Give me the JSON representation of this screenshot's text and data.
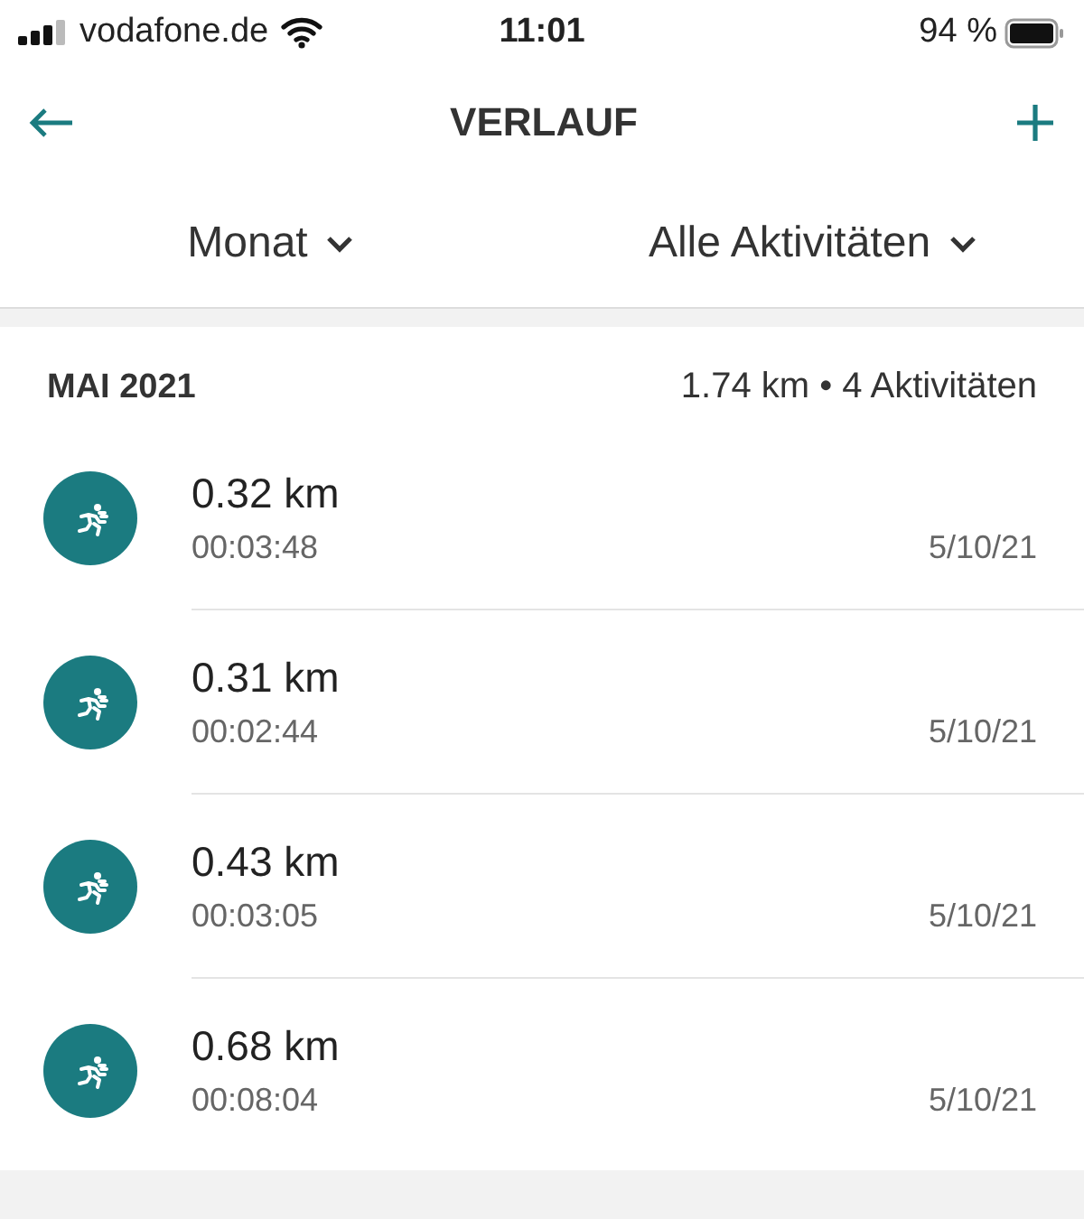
{
  "status_bar": {
    "carrier": "vodafone.de",
    "time": "11:01",
    "battery": "94 %"
  },
  "nav": {
    "title": "VERLAUF"
  },
  "filters": [
    {
      "label": "Monat"
    },
    {
      "label": "Alle Aktivitäten"
    }
  ],
  "section": {
    "title": "MAI 2021",
    "summary": "1.74 km • 4 Aktivitäten"
  },
  "activities": [
    {
      "distance": "0.32 km",
      "duration": "00:03:48",
      "date": "5/10/21"
    },
    {
      "distance": "0.31 km",
      "duration": "00:02:44",
      "date": "5/10/21"
    },
    {
      "distance": "0.43 km",
      "duration": "00:03:05",
      "date": "5/10/21"
    },
    {
      "distance": "0.68 km",
      "duration": "00:08:04",
      "date": "5/10/21"
    }
  ]
}
